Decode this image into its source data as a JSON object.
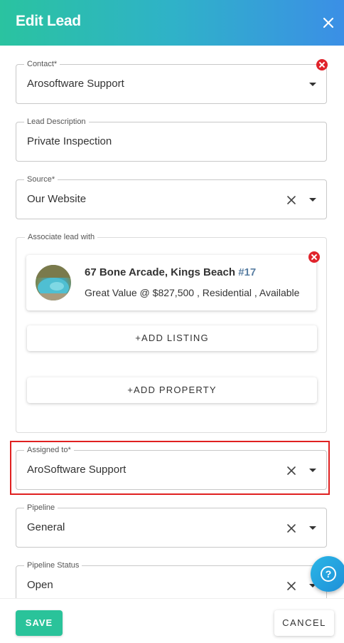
{
  "header": {
    "title": "Edit Lead"
  },
  "contact": {
    "legend": "Contact*",
    "value": "Arosoftware Support"
  },
  "lead_description": {
    "legend": "Lead Description",
    "value": "Private Inspection"
  },
  "source": {
    "legend": "Source*",
    "value": "Our Website"
  },
  "associate": {
    "legend": "Associate lead with",
    "listing": {
      "title": "67 Bone Arcade, Kings Beach",
      "number": "#17",
      "details": "Great Value @ $827,500 , Residential , Available"
    },
    "add_listing_label": "+ADD LISTING",
    "add_property_label": "+ADD PROPERTY"
  },
  "assigned_to": {
    "legend": "Assigned to*",
    "value": "AroSoftware Support"
  },
  "pipeline": {
    "legend": "Pipeline",
    "value": "General"
  },
  "pipeline_status": {
    "legend": "Pipeline Status",
    "value": "Open"
  },
  "footer": {
    "save_label": "SAVE",
    "cancel_label": "CANCEL"
  },
  "colors": {
    "header_start": "#2ac3a0",
    "header_end": "#3b8fe6",
    "save": "#2ac39a",
    "remove": "#e0232b",
    "highlight": "#e02020"
  },
  "icons": {
    "close": "close-icon",
    "remove": "remove-circle-icon",
    "clear": "clear-icon",
    "dropdown": "chevron-down-icon",
    "help": "help-icon"
  }
}
